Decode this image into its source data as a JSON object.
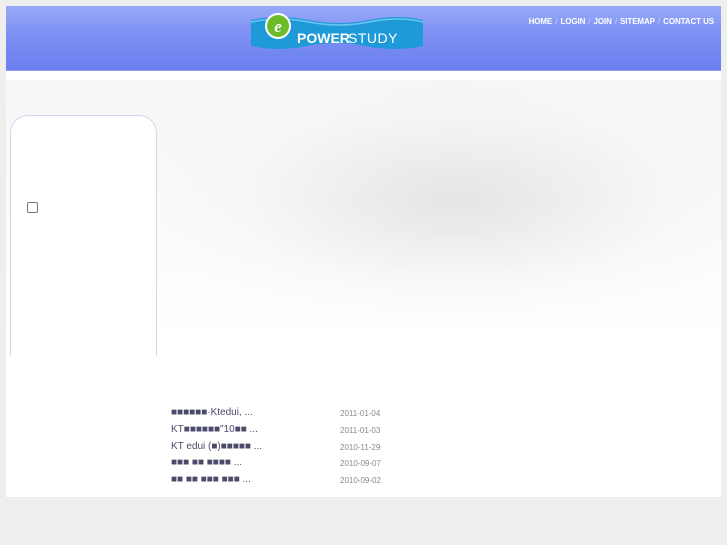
{
  "header": {
    "logo_letter": "e",
    "logo_power": "POWER",
    "logo_study": "STUDY",
    "nav": [
      "HOME",
      "LOGIN",
      "JOIN",
      "SITEMAP",
      "CONTACT US"
    ],
    "nav_separator": "/"
  },
  "news": [
    {
      "title": "■■■■■■·Ktedui, ...",
      "date": "2011-01-04"
    },
    {
      "title": "KT■■■■■■\"10■■ ...",
      "date": "2011-01-03"
    },
    {
      "title": "KT edui (■)■■■■■ ...",
      "date": "2010-11-29"
    },
    {
      "title": "■■■ ■■ ■■■■ ...",
      "date": "2010-09-07"
    },
    {
      "title": "■■ ■■ ■■■ ■■■ ...",
      "date": "2010-09-02"
    }
  ],
  "colors": {
    "header_blue": "#7f91f3",
    "logo_banner": "#1e9ad8",
    "logo_green": "#6cbb2a"
  }
}
